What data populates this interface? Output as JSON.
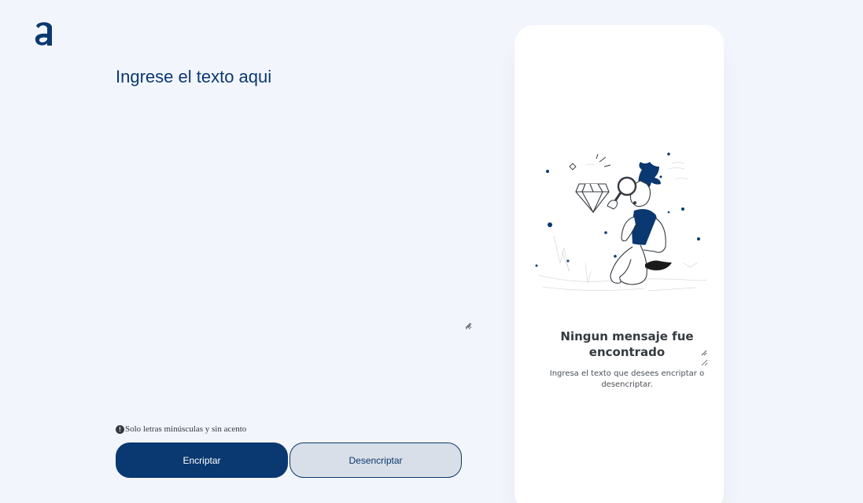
{
  "logo": {
    "icon": "alura-logo-icon",
    "color": "#0a3871"
  },
  "input": {
    "placeholder": "Ingrese el texto aqui",
    "value": ""
  },
  "hint": {
    "icon": "info-icon",
    "text": "Solo letras minúsculas y sin acento"
  },
  "buttons": {
    "encrypt_label": "Encriptar",
    "decrypt_label": "Desencriptar"
  },
  "output": {
    "illustration": "person-with-magnifier-illustration",
    "title": "Ningun mensaje fue encontrado",
    "text": "Ingresa el texto que desees encriptar o desencriptar."
  },
  "colors": {
    "background": "#f3f5fc",
    "accent": "#0a3871",
    "secondary_button": "#d8dfe8"
  }
}
